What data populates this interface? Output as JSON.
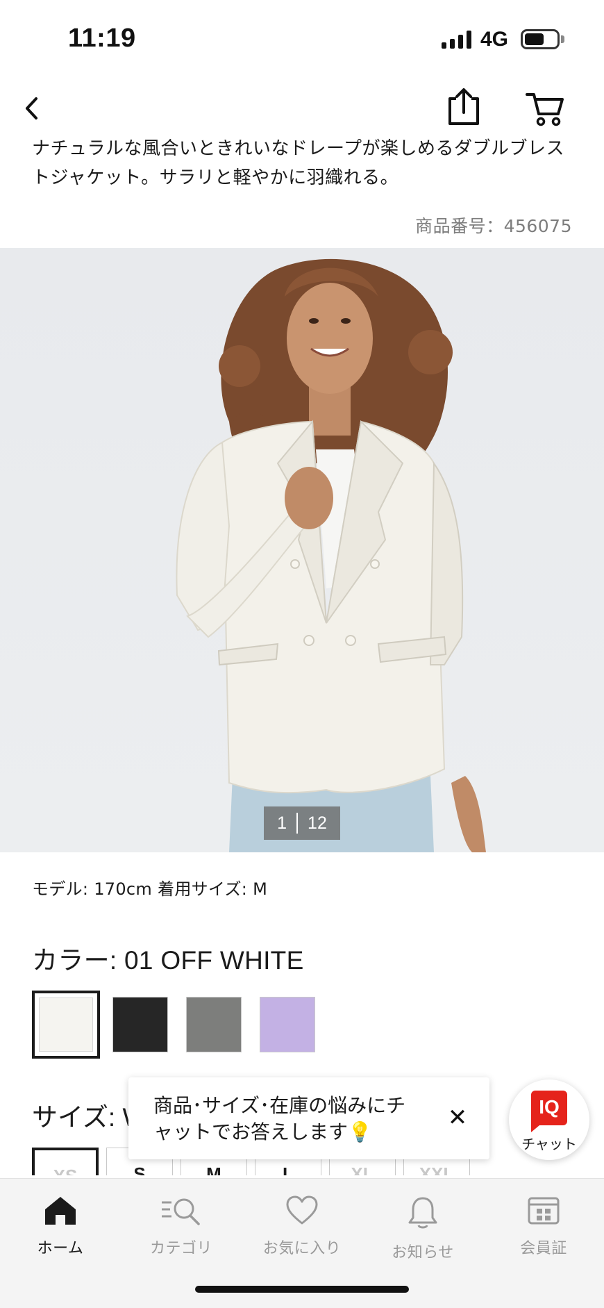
{
  "status_bar": {
    "time": "11:19",
    "network": "4G"
  },
  "product": {
    "description": "ナチュラルな風合いときれいなドレープが楽しめるダブルブレストジャケット。サラリと軽やかに羽織れる。",
    "product_number": "商品番号：456075",
    "image_counter": {
      "current": "1",
      "total": "12"
    },
    "model_info": "モデル: 170cm 着用サイズ: M",
    "color_label": "カラー: 01 OFF WHITE",
    "colors": [
      {
        "name": "OFF WHITE",
        "hex": "#f5f4f0"
      },
      {
        "name": "BLACK",
        "hex": "#262626"
      },
      {
        "name": "GRAY",
        "hex": "#7d7e7c"
      },
      {
        "name": "PURPLE",
        "hex": "#c3b1e4"
      }
    ],
    "size_label": "サイズ: W",
    "sizes": [
      "XS",
      "S",
      "M",
      "L",
      "XL",
      "XXL"
    ]
  },
  "chat": {
    "tooltip_line1": "商品･サイズ･在庫の悩みにチ",
    "tooltip_line2": "ャットでお答えします💡",
    "close": "✕",
    "iq_badge": "IQ",
    "iq_label": "チャット"
  },
  "tabbar": {
    "items": [
      {
        "label": "ホーム",
        "icon": "home-icon"
      },
      {
        "label": "カテゴリ",
        "icon": "category-search-icon"
      },
      {
        "label": "お気に入り",
        "icon": "heart-icon"
      },
      {
        "label": "お知らせ",
        "icon": "bell-icon"
      },
      {
        "label": "会員証",
        "icon": "member-card-icon"
      }
    ]
  },
  "colors": {
    "accent": "#e5231b",
    "text": "#1b1b1b",
    "muted": "#9a9a9a"
  }
}
